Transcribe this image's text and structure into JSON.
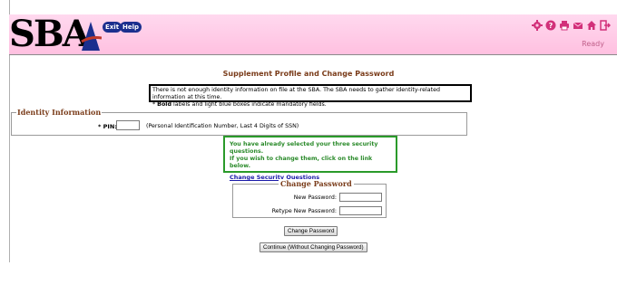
{
  "header": {
    "logo_text": "SBA",
    "exit_label": "Exit",
    "help_label": "Help",
    "status": "Ready",
    "icons": [
      "settings-icon",
      "help-icon",
      "print-icon",
      "mail-icon",
      "home-icon",
      "logout-icon"
    ],
    "colors": {
      "header_bg": "#ffc6e4",
      "pill": "#1b2f8e",
      "accent_text": "#7a3c1a"
    }
  },
  "page": {
    "title": "Supplement Profile and Change Password",
    "notice_line1": "There is not enough identity information on file at the SBA. The SBA needs to gather identity-related information at this time.",
    "notice_line2_prefix": "* ",
    "notice_line2_bold": "Bold",
    "notice_line2_rest": " labels and light blue boxes indicate mandatory fields."
  },
  "identity": {
    "legend": "Identity Information",
    "pin_label": "* PIN:",
    "pin_value": "",
    "pin_hint": "(Personal Identification Number, Last 4 Digits of SSN)"
  },
  "security": {
    "line1": "You have already selected your three security questions.",
    "line2": "If you wish to change them, click on the link below.",
    "link": "Change Security Questions"
  },
  "change_password": {
    "legend": "Change Password",
    "new_label": "New Password:",
    "retype_label": "Retype New Password:",
    "new_value": "",
    "retype_value": ""
  },
  "buttons": {
    "change": "Change Password",
    "continue": "Continue (Without Changing Password)"
  }
}
